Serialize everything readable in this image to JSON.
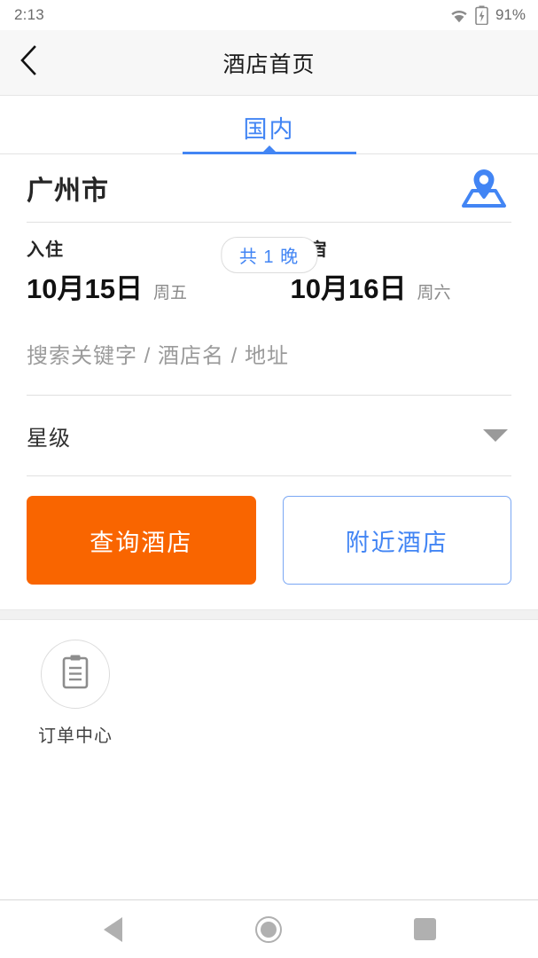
{
  "status_bar": {
    "time": "2:13",
    "battery_percent": "91%",
    "wifi_icon": "wifi-icon",
    "battery_icon": "battery-charging-icon"
  },
  "app_bar": {
    "back_icon": "chevron-left-icon",
    "title": "酒店首页"
  },
  "tabs": {
    "items": [
      {
        "label": "国内",
        "active": true
      }
    ],
    "accent_color": "#4285f4"
  },
  "search_card": {
    "city": {
      "name": "广州市",
      "map_icon": "map-location-icon"
    },
    "checkin": {
      "caption": "入住",
      "date": "10月15日",
      "weekday": "周五"
    },
    "checkout": {
      "caption": "离宿",
      "date": "10月16日",
      "weekday": "周六"
    },
    "nights_badge": "共 1 晚",
    "keyword": {
      "value": "",
      "placeholder": "搜索关键字 / 酒店名 / 地址"
    },
    "star_level": {
      "label": "星级",
      "dropdown_icon": "chevron-down-icon"
    },
    "buttons": {
      "primary": "查询酒店",
      "secondary": "附近酒店"
    }
  },
  "quick_entries": {
    "items": [
      {
        "label": "订单中心",
        "icon": "clipboard-icon"
      }
    ]
  },
  "nav_bar": {
    "back": "nav-back-icon",
    "home": "nav-home-icon",
    "recents": "nav-recents-icon"
  },
  "colors": {
    "accent_blue": "#4285f4",
    "accent_orange": "#f96500",
    "text_primary": "#262626",
    "text_muted": "#9b9b9b"
  }
}
